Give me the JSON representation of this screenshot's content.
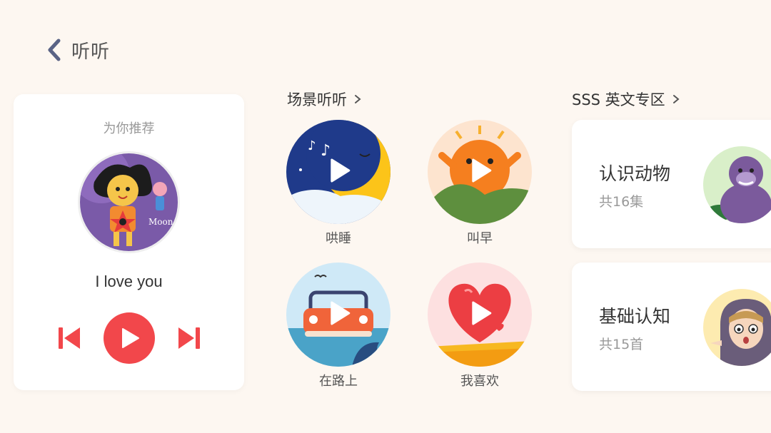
{
  "header": {
    "title": "听听"
  },
  "recommend": {
    "label": "为你推荐",
    "song_title": "I love you",
    "album_art_text": "Moon"
  },
  "scenes": {
    "title": "场景听听",
    "items": [
      {
        "label": "哄睡",
        "icon": "moon-night-icon"
      },
      {
        "label": "叫早",
        "icon": "sunrise-icon"
      },
      {
        "label": "在路上",
        "icon": "car-icon"
      },
      {
        "label": "我喜欢",
        "icon": "heart-icon"
      }
    ]
  },
  "english": {
    "title": "SSS 英文专区",
    "items": [
      {
        "title": "认识动物",
        "count": "共16集",
        "icon": "gorilla-icon"
      },
      {
        "title": "基础认知",
        "count": "共15首",
        "icon": "kid-hood-icon"
      }
    ]
  },
  "colors": {
    "accent": "#f2474b",
    "background": "#fdf7f1",
    "back_arrow": "#5a6385"
  }
}
